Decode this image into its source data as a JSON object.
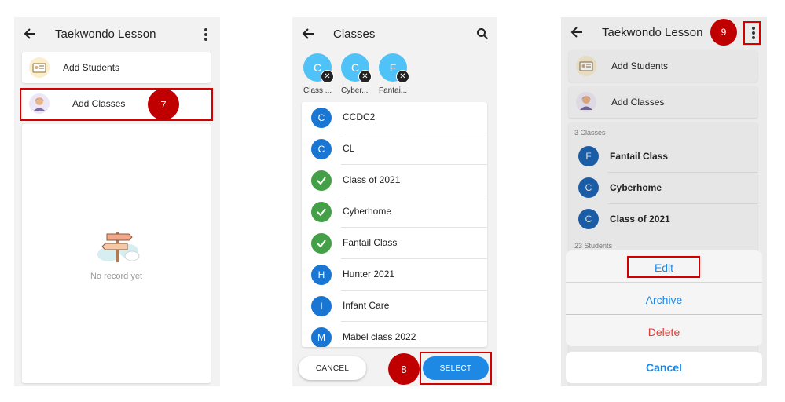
{
  "panel1": {
    "title": "Taekwondo Lesson",
    "items": [
      {
        "label": "Add Students"
      },
      {
        "label": "Add Classes"
      }
    ],
    "step_marker": "7",
    "empty_text": "No record yet"
  },
  "panel2": {
    "title": "Classes",
    "selected_chips": [
      {
        "letter": "C",
        "label": "Class ..."
      },
      {
        "letter": "C",
        "label": "Cyber..."
      },
      {
        "letter": "F",
        "label": "Fantai..."
      }
    ],
    "classes": [
      {
        "letter": "C",
        "name": "CCDC2",
        "selected": false
      },
      {
        "letter": "C",
        "name": "CL",
        "selected": false
      },
      {
        "letter": "",
        "name": "Class of 2021",
        "selected": true
      },
      {
        "letter": "",
        "name": "Cyberhome",
        "selected": true
      },
      {
        "letter": "",
        "name": "Fantail Class",
        "selected": true
      },
      {
        "letter": "H",
        "name": "Hunter 2021",
        "selected": false
      },
      {
        "letter": "I",
        "name": "Infant Care",
        "selected": false
      },
      {
        "letter": "M",
        "name": "Mabel class 2022",
        "selected": false
      }
    ],
    "cancel_label": "CANCEL",
    "select_label": "SELECT",
    "step_marker": "8"
  },
  "panel3": {
    "title": "Taekwondo Lesson",
    "step_marker": "9",
    "items": [
      {
        "label": "Add Students"
      },
      {
        "label": "Add Classes"
      }
    ],
    "classes_header": "3 Classes",
    "classes": [
      {
        "letter": "F",
        "name": "Fantail Class"
      },
      {
        "letter": "C",
        "name": "Cyberhome"
      },
      {
        "letter": "C",
        "name": "Class of 2021"
      }
    ],
    "students_header": "23 Students",
    "sheet": {
      "edit": "Edit",
      "archive": "Archive",
      "delete": "Delete",
      "cancel": "Cancel"
    }
  },
  "colors": {
    "accent_blue": "#1976d2",
    "check_green": "#43a047",
    "chip_blue": "#4fc3f7",
    "highlight_red": "#d40000",
    "marker_red": "#c00000",
    "delete_red": "#e53935",
    "action_blue": "#1e88e5"
  }
}
